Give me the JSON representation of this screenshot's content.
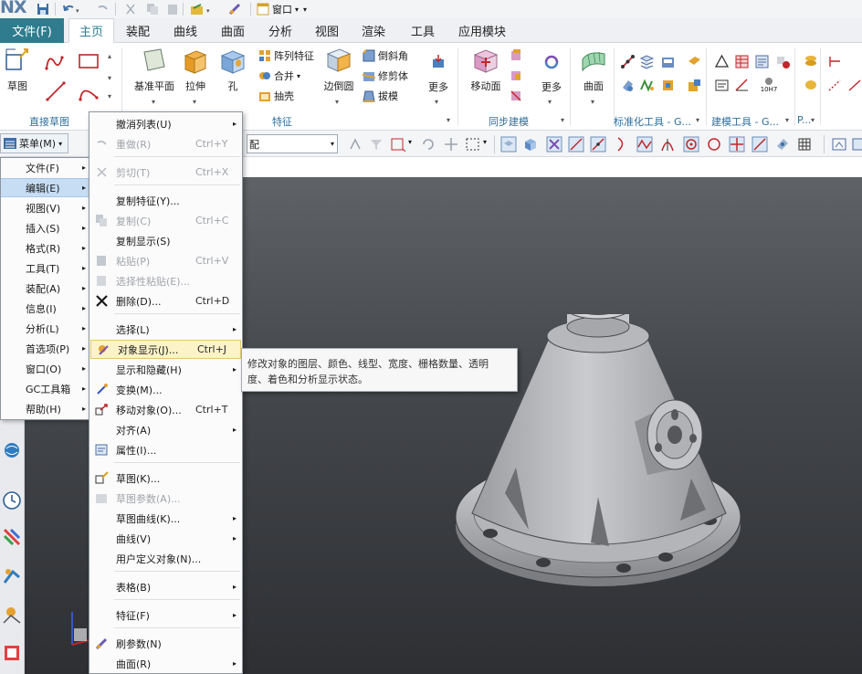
{
  "app": {
    "logo": "NX"
  },
  "quick_access": {
    "window_label": "窗口"
  },
  "tabs": [
    {
      "label": "文件(F)"
    },
    {
      "label": "主页"
    },
    {
      "label": "装配"
    },
    {
      "label": "曲线"
    },
    {
      "label": "曲面"
    },
    {
      "label": "分析"
    },
    {
      "label": "视图"
    },
    {
      "label": "渲染"
    },
    {
      "label": "工具"
    },
    {
      "label": "应用模块"
    }
  ],
  "ribbon": {
    "sketch": "草图",
    "datum_plane": "基准平面",
    "extrude": "拉伸",
    "hole": "孔",
    "pattern_feature": "阵列特征",
    "unite": "合并",
    "shell": "抽壳",
    "edge_blend": "边倒圆",
    "chamfer": "倒斜角",
    "trim_body": "修剪体",
    "draft": "拔模",
    "more1": "更多",
    "move_face": "移动面",
    "more2": "更多",
    "surface": "曲面",
    "group_direct_sketch": "直接草图",
    "group_feature": "特征",
    "group_sync_modeling": "同步建模",
    "group_standard_tools": "标准化工具 - G...",
    "group_build_tools": "建模工具 - G...",
    "group_extra": "P...",
    "tool_10h7": "10H7"
  },
  "selbar": {
    "menu_button": "菜单(M)",
    "filter_value": "配"
  },
  "main_menu": [
    {
      "label": "文件(F)",
      "sub": "▸"
    },
    {
      "label": "编辑(E)",
      "sub": "▸"
    },
    {
      "label": "视图(V)",
      "sub": "▸"
    },
    {
      "label": "插入(S)",
      "sub": "▸"
    },
    {
      "label": "格式(R)",
      "sub": "▸"
    },
    {
      "label": "工具(T)",
      "sub": "▸"
    },
    {
      "label": "装配(A)",
      "sub": "▸"
    },
    {
      "label": "信息(I)",
      "sub": "▸"
    },
    {
      "label": "分析(L)",
      "sub": "▸"
    },
    {
      "label": "首选项(P)",
      "sub": "▸"
    },
    {
      "label": "窗口(O)",
      "sub": "▸"
    },
    {
      "label": "GC工具箱",
      "sub": "▸"
    },
    {
      "label": "帮助(H)",
      "sub": "▸"
    }
  ],
  "edit_menu": [
    {
      "label": "撤消列表(U)",
      "shortcut": "",
      "sub": "▸"
    },
    {
      "label": "重做(R)",
      "shortcut": "Ctrl+Y",
      "sub": ""
    },
    {
      "label": "剪切(T)",
      "shortcut": "Ctrl+X",
      "sub": ""
    },
    {
      "label": "复制特征(Y)...",
      "shortcut": "",
      "sub": ""
    },
    {
      "label": "复制(C)",
      "shortcut": "Ctrl+C",
      "sub": ""
    },
    {
      "label": "复制显示(S)",
      "shortcut": "",
      "sub": ""
    },
    {
      "label": "粘贴(P)",
      "shortcut": "Ctrl+V",
      "sub": ""
    },
    {
      "label": "选择性粘贴(E)...",
      "shortcut": "",
      "sub": ""
    },
    {
      "label": "删除(D)...",
      "shortcut": "Ctrl+D",
      "sub": ""
    },
    {
      "label": "选择(L)",
      "shortcut": "",
      "sub": "▸"
    },
    {
      "label": "对象显示(J)...",
      "shortcut": "Ctrl+J",
      "sub": ""
    },
    {
      "label": "显示和隐藏(H)",
      "shortcut": "",
      "sub": "▸"
    },
    {
      "label": "变换(M)...",
      "shortcut": "",
      "sub": ""
    },
    {
      "label": "移动对象(O)...",
      "shortcut": "Ctrl+T",
      "sub": ""
    },
    {
      "label": "对齐(A)",
      "shortcut": "",
      "sub": "▸"
    },
    {
      "label": "属性(I)...",
      "shortcut": "",
      "sub": ""
    },
    {
      "label": "草图(K)...",
      "shortcut": "",
      "sub": ""
    },
    {
      "label": "草图参数(A)...",
      "shortcut": "",
      "sub": ""
    },
    {
      "label": "草图曲线(K)...",
      "shortcut": "",
      "sub": "▸"
    },
    {
      "label": "曲线(V)",
      "shortcut": "",
      "sub": "▸"
    },
    {
      "label": "用户定义对象(N)...",
      "shortcut": "",
      "sub": ""
    },
    {
      "label": "表格(B)",
      "shortcut": "",
      "sub": "▸"
    },
    {
      "label": "特征(F)",
      "shortcut": "",
      "sub": "▸"
    },
    {
      "label": "刷参数(N)",
      "shortcut": "",
      "sub": ""
    },
    {
      "label": "曲面(R)",
      "shortcut": "",
      "sub": "▸"
    }
  ],
  "tooltip": {
    "line1": "修改对象的图层、颜色、线型、宽度、栅格数量、透明",
    "line2": "度、着色和分析显示状态。"
  },
  "colors": {
    "accent": "#2f7c8e",
    "menu_highlight": "#c6ddf4",
    "submenu_highlight": "#fdf3c9",
    "viewport_bg": "#3b3d41"
  }
}
